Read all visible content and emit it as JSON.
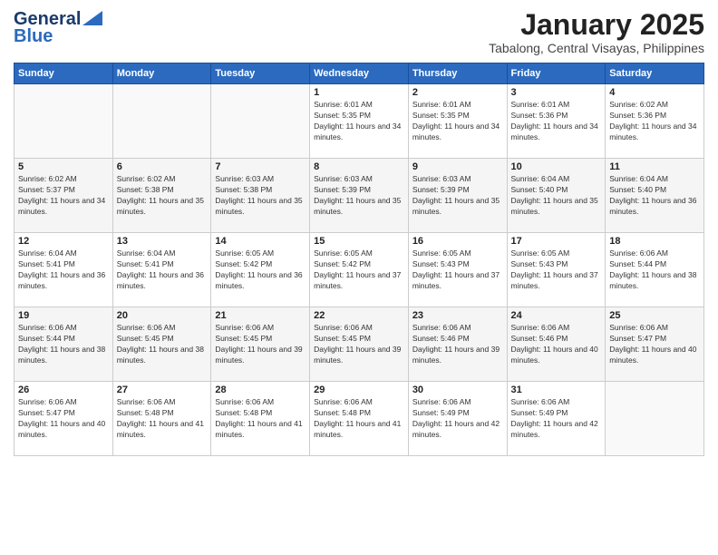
{
  "header": {
    "logo_line1": "General",
    "logo_line2": "Blue",
    "title": "January 2025",
    "subtitle": "Tabalong, Central Visayas, Philippines"
  },
  "days_of_week": [
    "Sunday",
    "Monday",
    "Tuesday",
    "Wednesday",
    "Thursday",
    "Friday",
    "Saturday"
  ],
  "weeks": [
    [
      {
        "day": "",
        "info": ""
      },
      {
        "day": "",
        "info": ""
      },
      {
        "day": "",
        "info": ""
      },
      {
        "day": "1",
        "info": "Sunrise: 6:01 AM\nSunset: 5:35 PM\nDaylight: 11 hours and 34 minutes."
      },
      {
        "day": "2",
        "info": "Sunrise: 6:01 AM\nSunset: 5:35 PM\nDaylight: 11 hours and 34 minutes."
      },
      {
        "day": "3",
        "info": "Sunrise: 6:01 AM\nSunset: 5:36 PM\nDaylight: 11 hours and 34 minutes."
      },
      {
        "day": "4",
        "info": "Sunrise: 6:02 AM\nSunset: 5:36 PM\nDaylight: 11 hours and 34 minutes."
      }
    ],
    [
      {
        "day": "5",
        "info": "Sunrise: 6:02 AM\nSunset: 5:37 PM\nDaylight: 11 hours and 34 minutes."
      },
      {
        "day": "6",
        "info": "Sunrise: 6:02 AM\nSunset: 5:38 PM\nDaylight: 11 hours and 35 minutes."
      },
      {
        "day": "7",
        "info": "Sunrise: 6:03 AM\nSunset: 5:38 PM\nDaylight: 11 hours and 35 minutes."
      },
      {
        "day": "8",
        "info": "Sunrise: 6:03 AM\nSunset: 5:39 PM\nDaylight: 11 hours and 35 minutes."
      },
      {
        "day": "9",
        "info": "Sunrise: 6:03 AM\nSunset: 5:39 PM\nDaylight: 11 hours and 35 minutes."
      },
      {
        "day": "10",
        "info": "Sunrise: 6:04 AM\nSunset: 5:40 PM\nDaylight: 11 hours and 35 minutes."
      },
      {
        "day": "11",
        "info": "Sunrise: 6:04 AM\nSunset: 5:40 PM\nDaylight: 11 hours and 36 minutes."
      }
    ],
    [
      {
        "day": "12",
        "info": "Sunrise: 6:04 AM\nSunset: 5:41 PM\nDaylight: 11 hours and 36 minutes."
      },
      {
        "day": "13",
        "info": "Sunrise: 6:04 AM\nSunset: 5:41 PM\nDaylight: 11 hours and 36 minutes."
      },
      {
        "day": "14",
        "info": "Sunrise: 6:05 AM\nSunset: 5:42 PM\nDaylight: 11 hours and 36 minutes."
      },
      {
        "day": "15",
        "info": "Sunrise: 6:05 AM\nSunset: 5:42 PM\nDaylight: 11 hours and 37 minutes."
      },
      {
        "day": "16",
        "info": "Sunrise: 6:05 AM\nSunset: 5:43 PM\nDaylight: 11 hours and 37 minutes."
      },
      {
        "day": "17",
        "info": "Sunrise: 6:05 AM\nSunset: 5:43 PM\nDaylight: 11 hours and 37 minutes."
      },
      {
        "day": "18",
        "info": "Sunrise: 6:06 AM\nSunset: 5:44 PM\nDaylight: 11 hours and 38 minutes."
      }
    ],
    [
      {
        "day": "19",
        "info": "Sunrise: 6:06 AM\nSunset: 5:44 PM\nDaylight: 11 hours and 38 minutes."
      },
      {
        "day": "20",
        "info": "Sunrise: 6:06 AM\nSunset: 5:45 PM\nDaylight: 11 hours and 38 minutes."
      },
      {
        "day": "21",
        "info": "Sunrise: 6:06 AM\nSunset: 5:45 PM\nDaylight: 11 hours and 39 minutes."
      },
      {
        "day": "22",
        "info": "Sunrise: 6:06 AM\nSunset: 5:45 PM\nDaylight: 11 hours and 39 minutes."
      },
      {
        "day": "23",
        "info": "Sunrise: 6:06 AM\nSunset: 5:46 PM\nDaylight: 11 hours and 39 minutes."
      },
      {
        "day": "24",
        "info": "Sunrise: 6:06 AM\nSunset: 5:46 PM\nDaylight: 11 hours and 40 minutes."
      },
      {
        "day": "25",
        "info": "Sunrise: 6:06 AM\nSunset: 5:47 PM\nDaylight: 11 hours and 40 minutes."
      }
    ],
    [
      {
        "day": "26",
        "info": "Sunrise: 6:06 AM\nSunset: 5:47 PM\nDaylight: 11 hours and 40 minutes."
      },
      {
        "day": "27",
        "info": "Sunrise: 6:06 AM\nSunset: 5:48 PM\nDaylight: 11 hours and 41 minutes."
      },
      {
        "day": "28",
        "info": "Sunrise: 6:06 AM\nSunset: 5:48 PM\nDaylight: 11 hours and 41 minutes."
      },
      {
        "day": "29",
        "info": "Sunrise: 6:06 AM\nSunset: 5:48 PM\nDaylight: 11 hours and 41 minutes."
      },
      {
        "day": "30",
        "info": "Sunrise: 6:06 AM\nSunset: 5:49 PM\nDaylight: 11 hours and 42 minutes."
      },
      {
        "day": "31",
        "info": "Sunrise: 6:06 AM\nSunset: 5:49 PM\nDaylight: 11 hours and 42 minutes."
      },
      {
        "day": "",
        "info": ""
      }
    ]
  ]
}
